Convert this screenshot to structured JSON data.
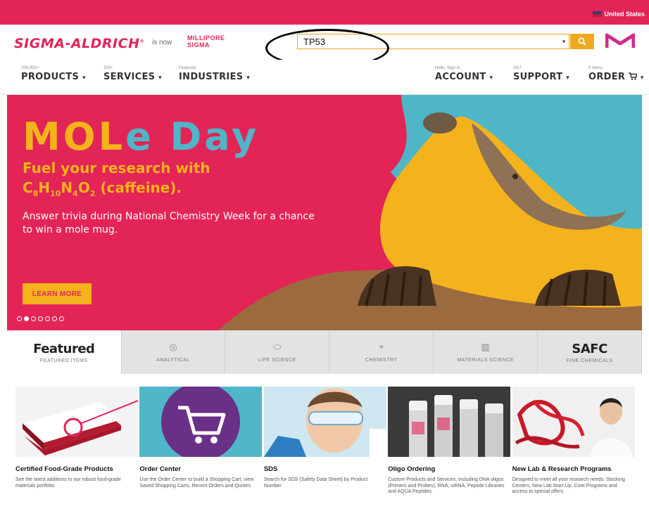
{
  "colors": {
    "brand": "#e32457",
    "accent": "#f0a91c",
    "teal": "#4fb6c8"
  },
  "topbar": {
    "region": "United States"
  },
  "header": {
    "logo": "SIGMA-ALDRICH",
    "is_now": "is now",
    "millipore": "MILLIPORE SIGMA",
    "search": {
      "value": "TP53"
    }
  },
  "nav": {
    "left": [
      {
        "small": "200,000+",
        "label": "PRODUCTS"
      },
      {
        "small": "100+",
        "label": "SERVICES"
      },
      {
        "small": "Featured",
        "label": "INDUSTRIES"
      }
    ],
    "right": [
      {
        "small": "Hello. Sign in.",
        "label": "ACCOUNT"
      },
      {
        "small": "24/7",
        "label": "SUPPORT"
      },
      {
        "small": "0 Items",
        "label": "ORDER"
      }
    ]
  },
  "hero": {
    "title_a": "MOL",
    "title_b": "e Day",
    "subtitle_line1": "Fuel your research with",
    "formula": {
      "c": "C",
      "c_n": "8",
      "h": "H",
      "h_n": "10",
      "n": "N",
      "n_n": "4",
      "o": "O",
      "o_n": "2",
      "suffix": " (caffeine)."
    },
    "description": "Answer trivia during National Chemistry Week for a chance to win a mole mug.",
    "cta": "LEARN MORE",
    "slides": 7,
    "active_slide": 1
  },
  "tabs": [
    {
      "big": "Featured",
      "small": "FEATURED ITEMS",
      "icon": "star-icon"
    },
    {
      "small": "ANALYTICAL",
      "icon": "analytical-icon"
    },
    {
      "small": "LIFE SCIENCE",
      "icon": "cell-icon"
    },
    {
      "small": "CHEMISTRY",
      "icon": "molecule-icon"
    },
    {
      "small": "MATERIALS SCIENCE",
      "icon": "materials-icon"
    },
    {
      "big": "SAFC",
      "small": "FINE CHEMICALS",
      "icon": "safc-icon"
    }
  ],
  "cards": [
    {
      "title": "Certified Food-Grade Products",
      "desc": "See the latest additions to our robust food-grade materials portfolio"
    },
    {
      "title": "Order Center",
      "desc": "Use the Order Center to build a Shopping Cart, view Saved Shopping Carts, Recent Orders and Quotes"
    },
    {
      "title": "SDS",
      "desc": "Search for SDS (Safety Data Sheet) by Product Number"
    },
    {
      "title": "Oligo Ordering",
      "desc": "Custom Products and Services, including DNA oligos (Primers and Probes), RNA, siRNA, Peptide Libraries and AQUA Peptides"
    },
    {
      "title": "New Lab & Research Programs",
      "desc": "Designed to meet all your research needs: Stocking Centers, New Lab Start-Up, Core Programs and access to special offers"
    }
  ]
}
